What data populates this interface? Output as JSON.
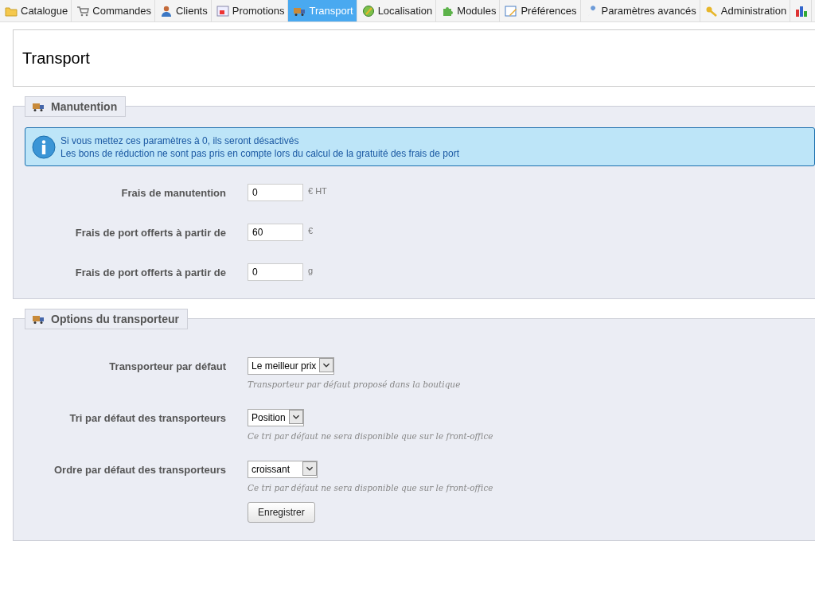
{
  "tabs": [
    {
      "label": "Catalogue",
      "selected": false
    },
    {
      "label": "Commandes",
      "selected": false
    },
    {
      "label": "Clients",
      "selected": false
    },
    {
      "label": "Promotions",
      "selected": false
    },
    {
      "label": "Transport",
      "selected": true
    },
    {
      "label": "Localisation",
      "selected": false
    },
    {
      "label": "Modules",
      "selected": false
    },
    {
      "label": "Préférences",
      "selected": false
    },
    {
      "label": "Paramètres avancés",
      "selected": false
    },
    {
      "label": "Administration",
      "selected": false
    }
  ],
  "page_title": "Transport",
  "sections": [
    {
      "title": "Manutention",
      "info": [
        "Si vous mettez ces paramètres à 0, ils seront désactivés",
        "Les bons de réduction ne sont pas pris en compte lors du calcul de la gratuité des frais de port"
      ],
      "fields": [
        {
          "kind": "input",
          "label": "Frais de manutention",
          "value": "0",
          "unit": "€ HT"
        },
        {
          "kind": "input",
          "label": "Frais de port offerts à partir de",
          "value": "60",
          "unit": "€"
        },
        {
          "kind": "input",
          "label": "Frais de port offerts à partir de",
          "value": "0",
          "unit": "g"
        }
      ]
    },
    {
      "title": "Options du transporteur",
      "fields": [
        {
          "kind": "select",
          "label": "Transporteur par défaut",
          "value": "Le meilleur prix",
          "hint": "Transporteur par défaut proposé dans la boutique"
        },
        {
          "kind": "select",
          "label": "Tri par défaut des transporteurs",
          "value": "Position",
          "hint": "Ce tri par défaut ne sera disponible que sur le front-office"
        },
        {
          "kind": "select",
          "label": "Ordre par défaut des transporteurs",
          "value": "croissant",
          "hint": "Ce tri par défaut ne sera disponible que sur le front-office",
          "wide": true
        }
      ],
      "button": "Enregistrer"
    }
  ]
}
